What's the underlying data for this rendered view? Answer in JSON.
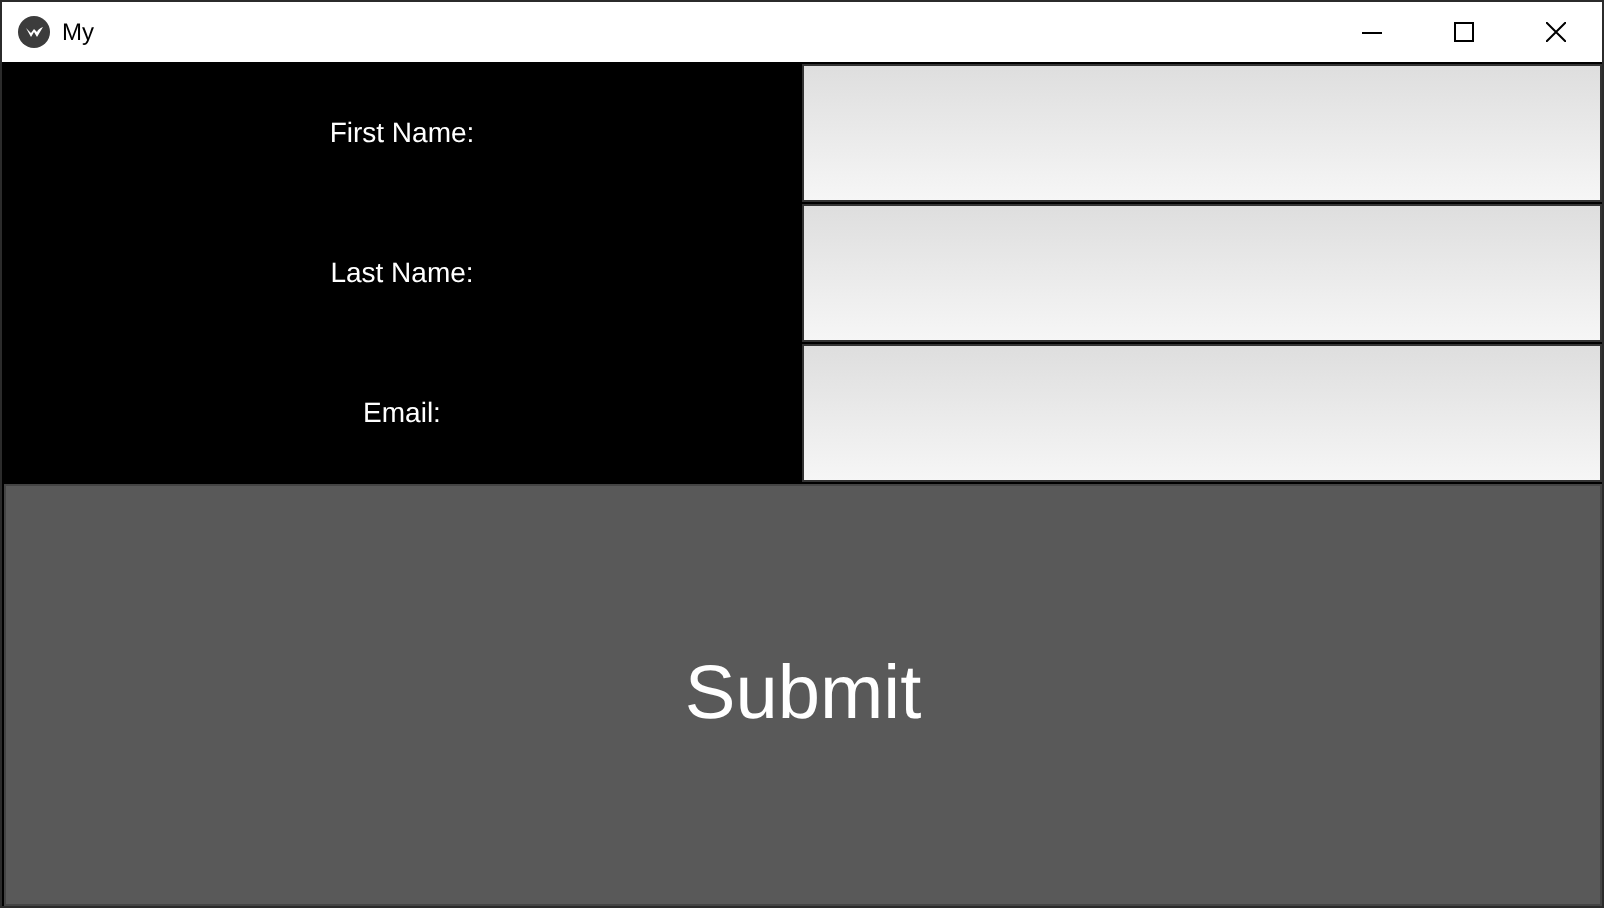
{
  "window": {
    "title": "My"
  },
  "fields": [
    {
      "label": "First Name:"
    },
    {
      "label": "Last Name:"
    },
    {
      "label": "Email:"
    }
  ],
  "submit": {
    "label": "Submit"
  }
}
